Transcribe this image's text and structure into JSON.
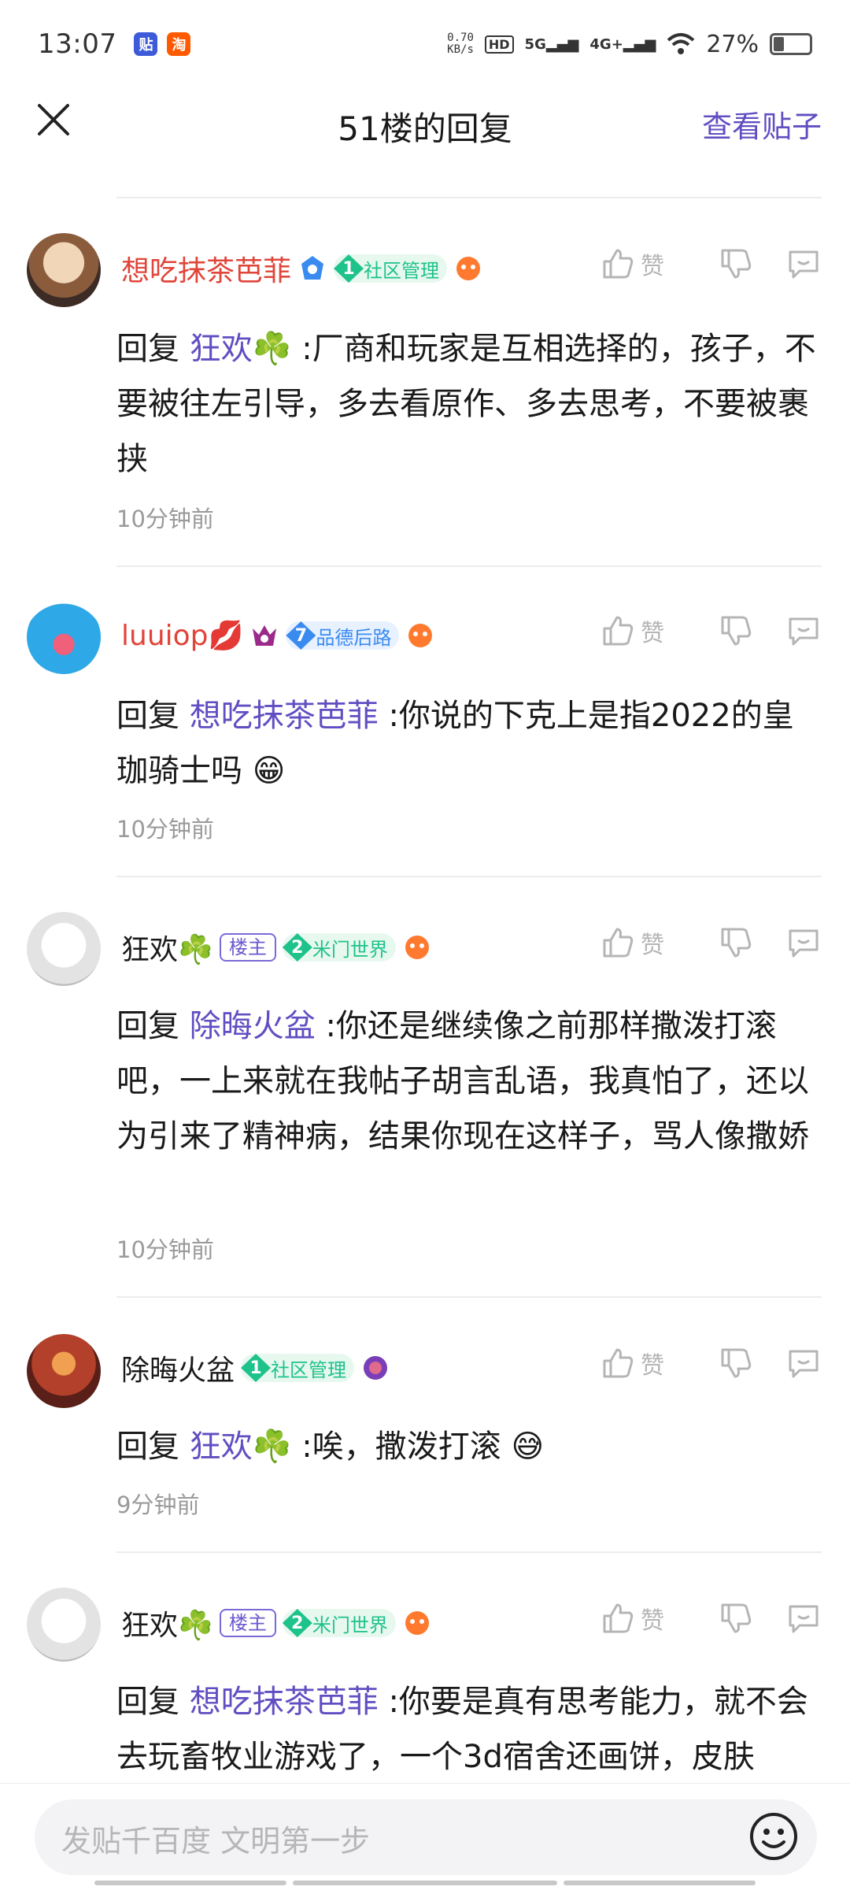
{
  "status": {
    "time": "13:07",
    "app1": "贴",
    "app2": "淘",
    "speed_value": "0.70",
    "speed_unit": "KB/s",
    "hd": "HD",
    "net1": "5G",
    "net2": "4G+",
    "battery": "27%",
    "battery_level": 0.27
  },
  "header": {
    "title": "51楼的回复",
    "view_post": "查看贴子"
  },
  "like_label": "赞",
  "comments": [
    {
      "name": "想吃抹茶芭菲",
      "name_color": "#e0453a",
      "level": "1",
      "level_label": "社区管理",
      "level_color": "#1ec28b",
      "reply_prefix": "回复",
      "reply_to": "狂欢☘️",
      "text": ":厂商和玩家是互相选择的，孩子，不要被往左引导，多去看原作、多去思考，不要被裹挟",
      "time": "10分钟前"
    },
    {
      "name": "luuiop💋",
      "name_color": "#e0453a",
      "level": "7",
      "level_label": "品德后路",
      "level_color": "#3a8bf0",
      "reply_prefix": "回复",
      "reply_to": "想吃抹茶芭菲",
      "text": ":你说的下克上是指2022的皇珈骑士吗 😁",
      "time": "10分钟前"
    },
    {
      "name": "狂欢☘️",
      "name_color": "#1a1a1a",
      "louzhu": "楼主",
      "level": "2",
      "level_label": "米门世界",
      "level_color": "#1ec28b",
      "reply_prefix": "回复",
      "reply_to": "除晦火盆",
      "text": ":你还是继续像之前那样撒泼打滚吧，一上来就在我帖子胡言乱语，我真怕了，还以为引来了精神病，结果你现在这样子，骂人像撒娇",
      "time": "10分钟前"
    },
    {
      "name": "除晦火盆",
      "name_color": "#1a1a1a",
      "level": "1",
      "level_label": "社区管理",
      "level_color": "#1ec28b",
      "reply_prefix": "回复",
      "reply_to": "狂欢☘️",
      "text": ":唉，撒泼打滚 😅",
      "time": "9分钟前"
    },
    {
      "name": "狂欢☘️",
      "name_color": "#1a1a1a",
      "louzhu": "楼主",
      "level": "2",
      "level_label": "米门世界",
      "level_color": "#1ec28b",
      "reply_prefix": "回复",
      "reply_to": "想吃抹茶芭菲",
      "text": ":你要是真有思考能力，就不会去玩畜牧业游戏了，一个3d宿舍还画饼，皮肤",
      "time": ""
    }
  ],
  "input": {
    "placeholder": "发贴千百度 文明第一步"
  }
}
